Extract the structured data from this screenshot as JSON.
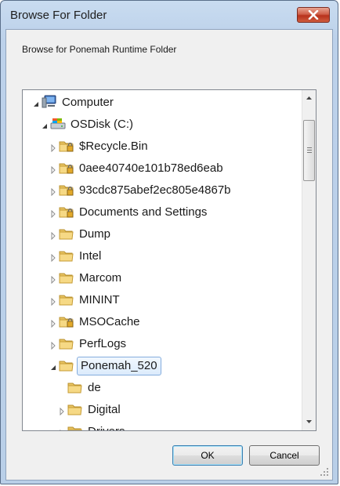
{
  "window": {
    "title": "Browse For Folder"
  },
  "description": "Browse for Ponemah Runtime Folder",
  "tree": [
    {
      "label": "Computer",
      "icon": "computer-icon",
      "expander": "expanded"
    },
    {
      "label": "OSDisk (C:)",
      "icon": "drive-icon",
      "expander": "expanded"
    },
    {
      "label": "$Recycle.Bin",
      "icon": "locked-folder-icon",
      "expander": "collapsed"
    },
    {
      "label": "0aee40740e101b78ed6eab",
      "icon": "locked-folder-icon",
      "expander": "collapsed"
    },
    {
      "label": "93cdc875abef2ec805e4867b",
      "icon": "locked-folder-icon",
      "expander": "collapsed"
    },
    {
      "label": "Documents and Settings",
      "icon": "locked-folder-icon",
      "expander": "collapsed"
    },
    {
      "label": "Dump",
      "icon": "folder-icon",
      "expander": "collapsed"
    },
    {
      "label": "Intel",
      "icon": "folder-icon",
      "expander": "collapsed"
    },
    {
      "label": "Marcom",
      "icon": "folder-icon",
      "expander": "collapsed"
    },
    {
      "label": "MININT",
      "icon": "folder-icon",
      "expander": "collapsed"
    },
    {
      "label": "MSOCache",
      "icon": "locked-folder-icon",
      "expander": "collapsed"
    },
    {
      "label": "PerfLogs",
      "icon": "folder-icon",
      "expander": "collapsed"
    },
    {
      "label": "Ponemah_520",
      "icon": "folder-icon",
      "expander": "expanded",
      "selected": true
    },
    {
      "label": "de",
      "icon": "folder-icon",
      "expander": "none"
    },
    {
      "label": "Digital",
      "icon": "folder-icon",
      "expander": "collapsed"
    },
    {
      "label": "Drivers",
      "icon": "folder-icon",
      "expander": "collapsed"
    }
  ],
  "buttons": {
    "ok": "OK",
    "cancel": "Cancel"
  },
  "colors": {
    "selection_border": "#84acdd",
    "close_button": "#c0392b",
    "folder": "#e8c25a"
  }
}
